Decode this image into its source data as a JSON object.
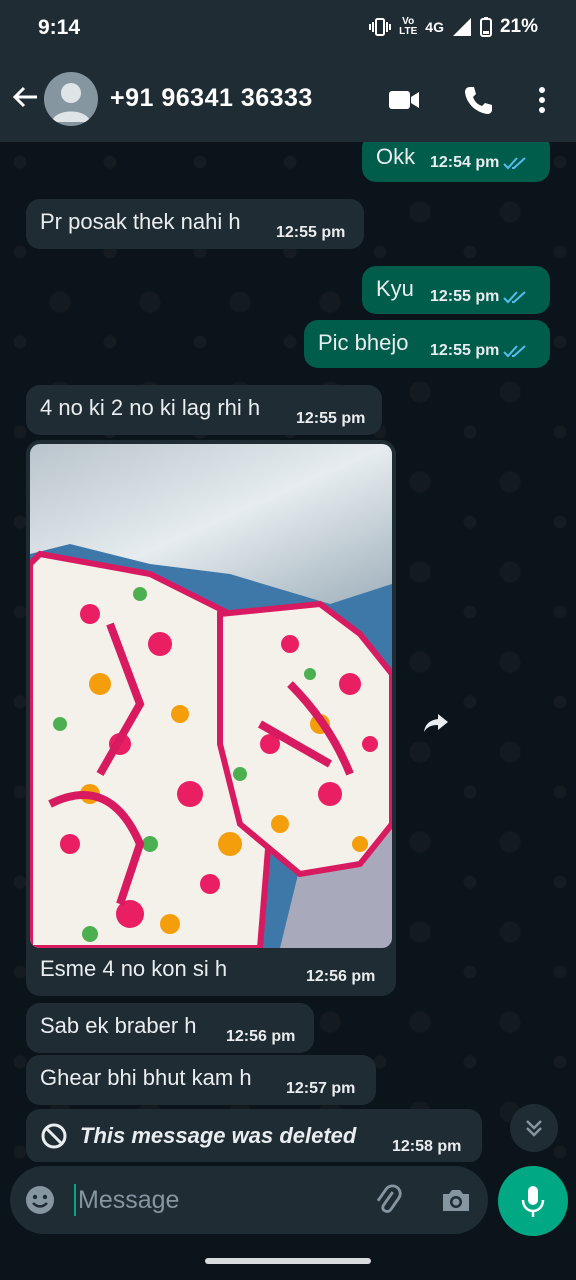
{
  "status_bar": {
    "time": "9:14",
    "volte_top": "Vo",
    "volte_bottom": "LTE",
    "network": "4G",
    "battery": "21%"
  },
  "header": {
    "contact": "+91 96341 36333",
    "icons": [
      "back-arrow-icon",
      "avatar",
      "video-call-icon",
      "phone-icon",
      "more-options-icon"
    ]
  },
  "messages": [
    {
      "dir": "out",
      "text": "Okk",
      "time": "12:54 pm",
      "read": true
    },
    {
      "dir": "in",
      "text": "Pr posak thek nahi h",
      "time": "12:55 pm"
    },
    {
      "dir": "out",
      "text": "Kyu",
      "time": "12:55 pm",
      "read": true
    },
    {
      "dir": "out",
      "text": "Pic bhejo",
      "time": "12:55 pm",
      "read": true
    },
    {
      "dir": "in",
      "text": "4 no ki 2 no ki lag rhi h",
      "time": "12:55 pm"
    },
    {
      "dir": "in",
      "type": "image",
      "caption": "Esme 4 no kon si h",
      "time": "12:56 pm"
    },
    {
      "dir": "in",
      "text": "Sab ek braber h",
      "time": "12:56 pm"
    },
    {
      "dir": "in",
      "text": "Ghear bhi bhut kam h",
      "time": "12:57 pm"
    },
    {
      "dir": "in",
      "type": "deleted",
      "text": "This message was deleted",
      "time": "12:58 pm"
    }
  ],
  "composer": {
    "placeholder": "Message"
  },
  "colors": {
    "background": "#0b141a",
    "bar": "#1f2c34",
    "incoming": "#1f2c34",
    "outgoing": "#005c4b",
    "accent": "#00a884",
    "read_ticks": "#53bdeb"
  }
}
